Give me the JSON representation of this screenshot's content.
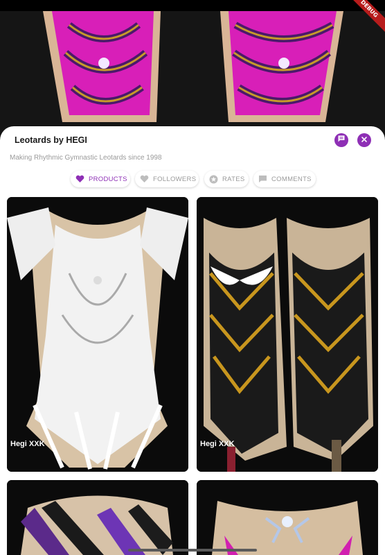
{
  "debug_banner": "DEBUG",
  "sheet": {
    "title": "Leotards by HEGI",
    "subtitle": "Making Rhythmic Gymnastic Leotards since 1998",
    "chat_icon": "chat-bubble-icon",
    "close_icon": "close-icon"
  },
  "tabs": [
    {
      "label": "PRODUCTS",
      "icon": "heart-icon",
      "active": true
    },
    {
      "label": "FOLLOWERS",
      "icon": "heart-icon",
      "active": false
    },
    {
      "label": "RATES",
      "icon": "star-icon",
      "active": false
    },
    {
      "label": "COMMENTS",
      "icon": "comment-icon",
      "active": false
    }
  ],
  "products": [
    {
      "name": "Hegi XXK"
    },
    {
      "name": "Hegi XXK"
    },
    {
      "name": ""
    },
    {
      "name": ""
    }
  ],
  "colors": {
    "accent": "#8e2fb5",
    "tab_inactive": "#9a9a9a"
  }
}
